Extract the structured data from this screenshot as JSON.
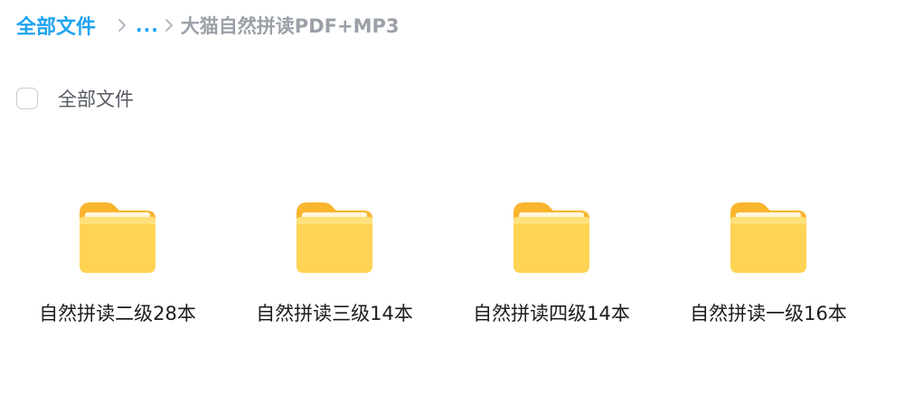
{
  "breadcrumb": {
    "root": "全部文件",
    "ellipsis": "...",
    "current": "大猫自然拼读PDF+MP3"
  },
  "select_all": {
    "label": "全部文件",
    "checked": false
  },
  "folders": [
    {
      "name": "自然拼读二级28本",
      "icon": "folder-icon"
    },
    {
      "name": "自然拼读三级14本",
      "icon": "folder-icon"
    },
    {
      "name": "自然拼读四级14本",
      "icon": "folder-icon"
    },
    {
      "name": "自然拼读一级16本",
      "icon": "folder-icon"
    }
  ],
  "colors": {
    "accent": "#1fa3f0",
    "folder_back": "#f9b52d",
    "folder_front": "#ffd454"
  }
}
